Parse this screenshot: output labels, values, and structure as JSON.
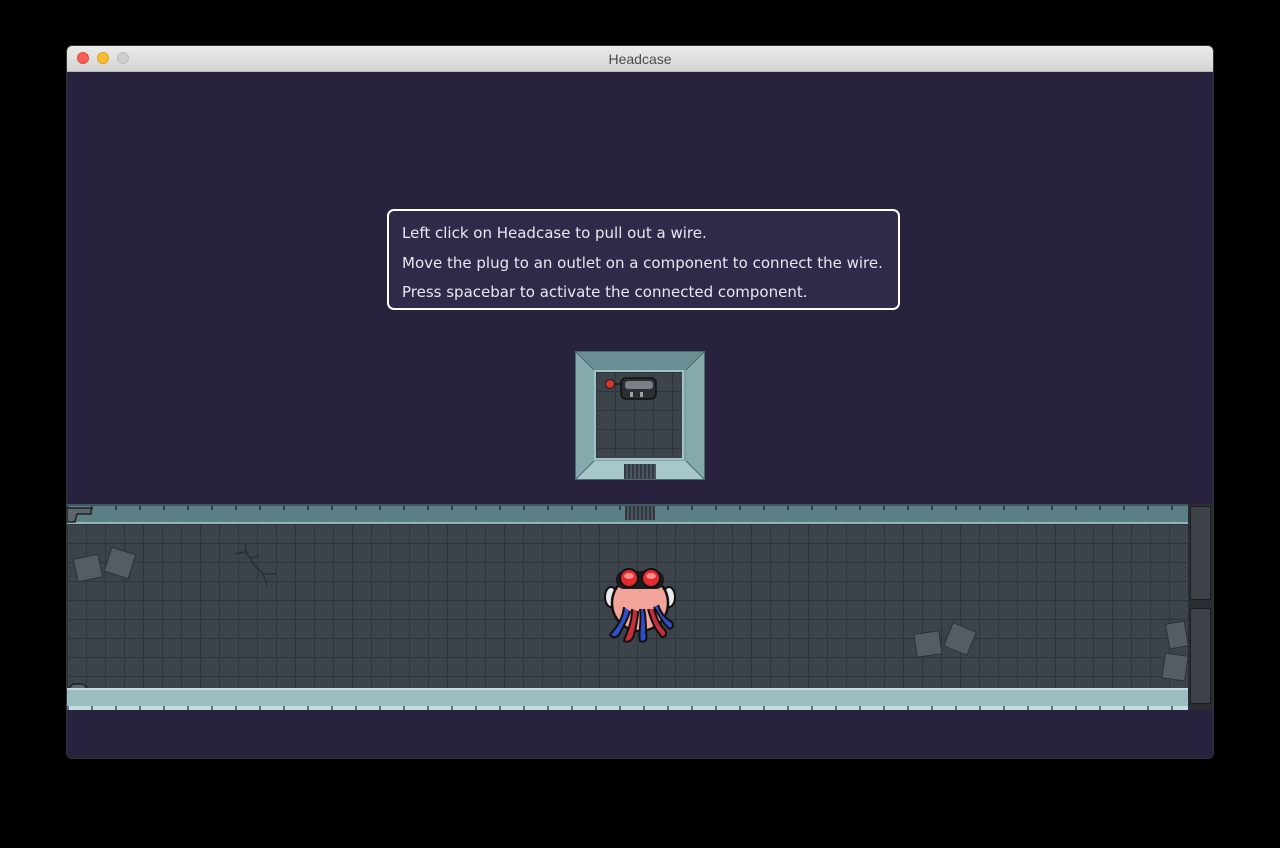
{
  "window": {
    "title": "Headcase"
  },
  "tutorial": {
    "lines": [
      "Left click on Headcase to pull out a wire.",
      "Move the plug to an outlet on a component to connect the wire.",
      "Press spacebar to activate the connected component."
    ]
  },
  "colors": {
    "background": "#28223f",
    "floor": "#3c434b",
    "wall": "#7fa0a6",
    "tooltip_border": "#ffffff"
  },
  "icons": [
    "close-icon",
    "minimize-icon",
    "maximize-icon",
    "plug-component-icon",
    "headcase-character-icon"
  ]
}
